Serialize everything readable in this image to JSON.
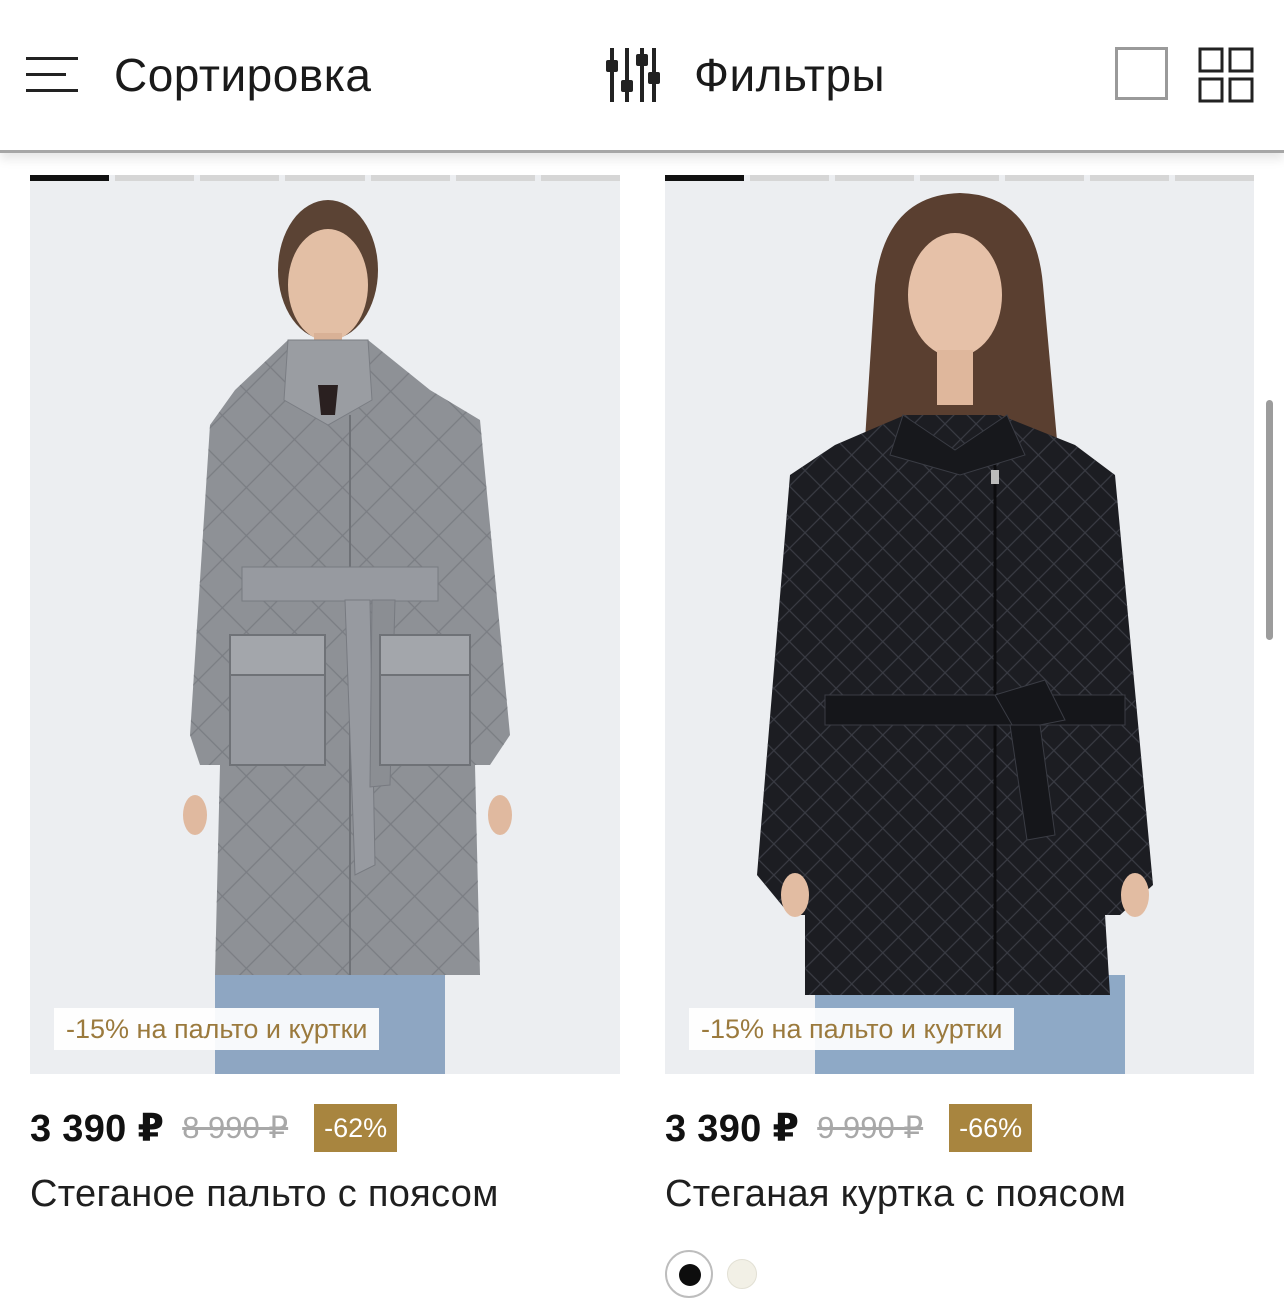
{
  "toolbar": {
    "sort_label": "Сортировка",
    "filter_label": "Фильтры"
  },
  "products": [
    {
      "promo": "-15% на пальто и куртки",
      "price": "3 390 ₽",
      "old_price": "8 990 ₽",
      "discount": "-62%",
      "title": "Стеганое пальто с поясом",
      "photo_slides": 7,
      "active_slide": 1,
      "garment_color": "#8e9196"
    },
    {
      "promo": "-15% на пальто и куртки",
      "price": "3 390 ₽",
      "old_price": "9 990 ₽",
      "discount": "-66%",
      "title": "Стеганая куртка с поясом",
      "photo_slides": 7,
      "active_slide": 1,
      "garment_color": "#1c1d22",
      "colors": [
        "#0d0d0d",
        "#f2f0e6"
      ],
      "selected_color": 0
    }
  ],
  "colors": {
    "promo_text": "#9b7a3d",
    "discount_bg": "#a8853f",
    "photo_bg": "#eceef1"
  }
}
